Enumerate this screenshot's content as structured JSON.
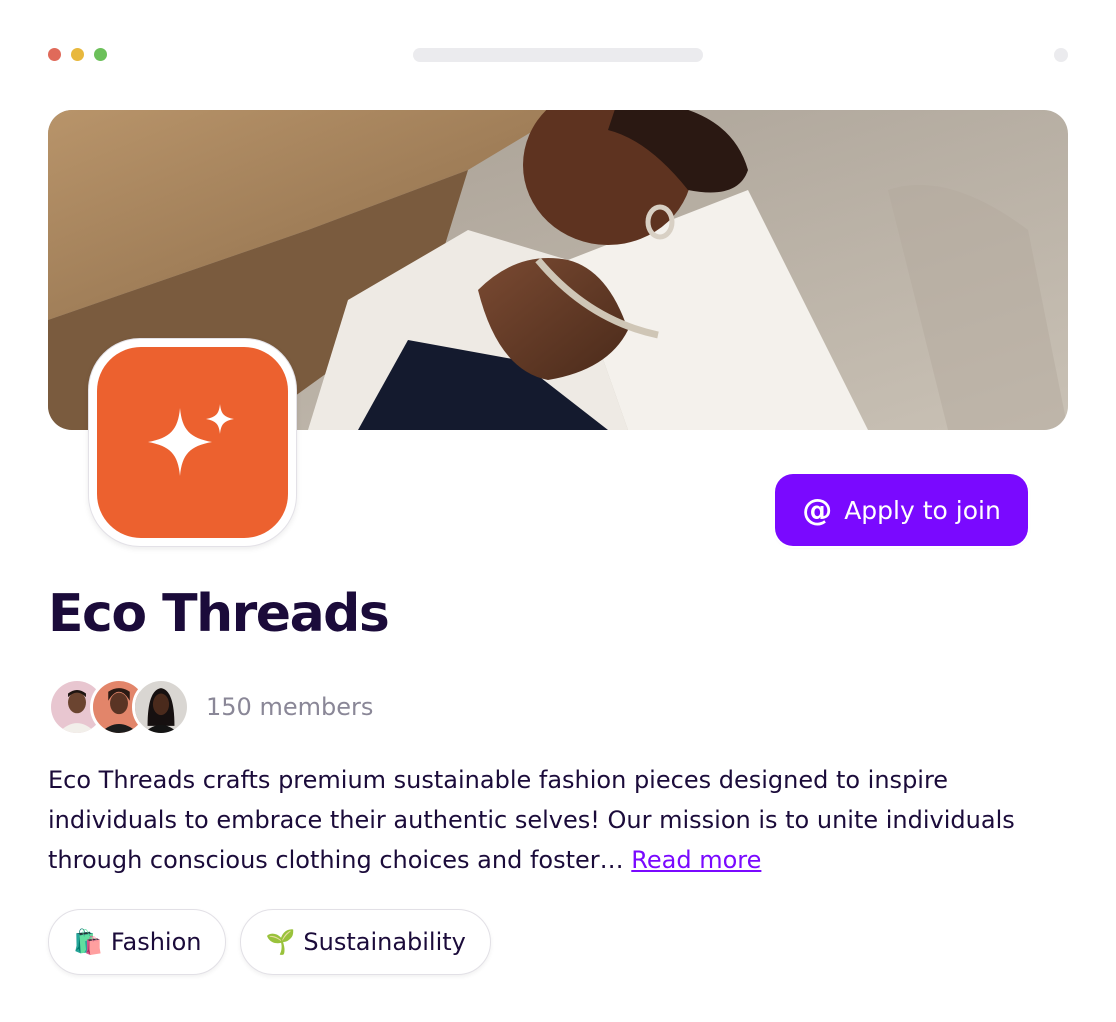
{
  "window": {
    "dot_colors": [
      "#e06a5a",
      "#e8b83d",
      "#6cc05a"
    ]
  },
  "community": {
    "name": "Eco Threads",
    "logo_icon": "sparkle-icon",
    "cover_image": "woman-in-white-shirt-photo",
    "apply_label": "Apply to join",
    "apply_icon": "at-sign-icon",
    "members_text": "150 members",
    "description": "Eco Threads crafts premium sustainable fashion pieces designed to inspire individuals to embrace their authentic selves! Our mission is to unite individuals through conscious clothing choices and foster…",
    "read_more": "Read more",
    "tags": [
      {
        "emoji": "🛍️",
        "label": "Fashion"
      },
      {
        "emoji": "🌱",
        "label": "Sustainability"
      }
    ]
  },
  "colors": {
    "brand_purple": "#7a09ff",
    "logo_orange": "#ec612f",
    "heading": "#1b0b3a",
    "muted": "#8a8797"
  }
}
